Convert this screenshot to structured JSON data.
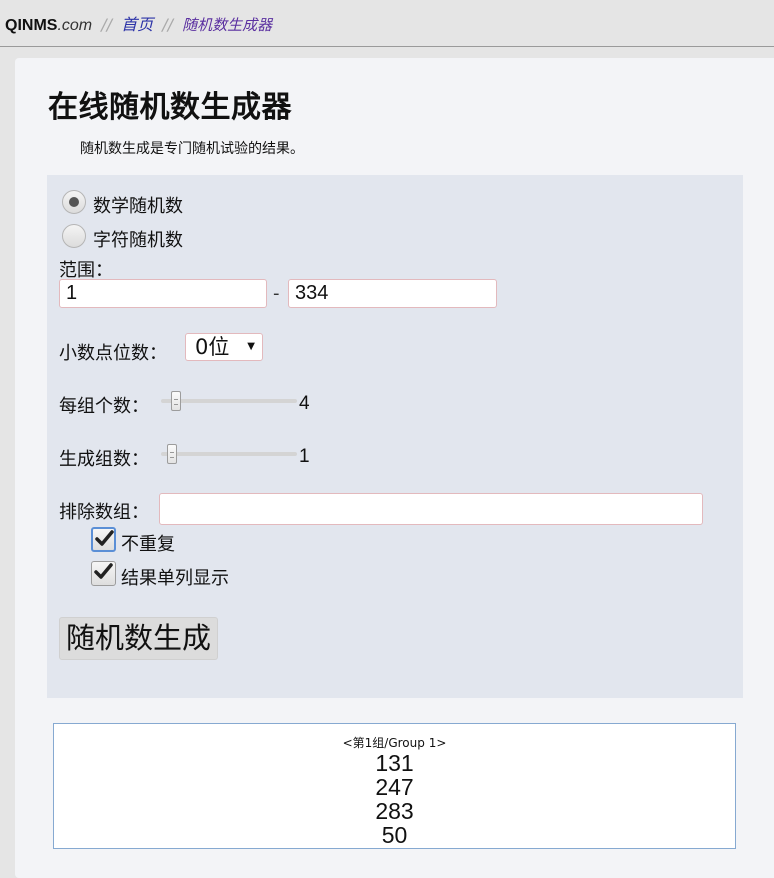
{
  "breadcrumb": {
    "brand_bold": "QINMS",
    "brand_rest": ".com",
    "separator": "//",
    "home": "首页",
    "current": "随机数生成器"
  },
  "page": {
    "title": "在线随机数生成器",
    "intro": "随机数生成是专门随机试验的结果。"
  },
  "form": {
    "mode_options": [
      {
        "label": "数学随机数",
        "checked": true
      },
      {
        "label": "字符随机数",
        "checked": false
      }
    ],
    "range_label": "范围：",
    "range_min": "1",
    "range_separator": "-",
    "range_max": "334",
    "decimal_label": "小数点位数：",
    "decimal_value": "0位",
    "per_group_label": "每组个数：",
    "per_group_value": "4",
    "group_count_label": "生成组数：",
    "group_count_value": "1",
    "exclude_label": "排除数组：",
    "exclude_value": "",
    "no_repeat_label": "不重复",
    "no_repeat_checked": true,
    "single_column_label": "结果单列显示",
    "single_column_checked": true,
    "submit_label": "随机数生成"
  },
  "result": {
    "group_header": "<第1组/Group 1>",
    "numbers": [
      "131",
      "247",
      "283",
      "50"
    ]
  },
  "colors": {
    "card_bg": "#f3f4f7",
    "panel_bg": "#e2e6ee",
    "input_border": "#e3b9bd",
    "result_border": "#86a9d1",
    "link": "#2c33a8"
  }
}
